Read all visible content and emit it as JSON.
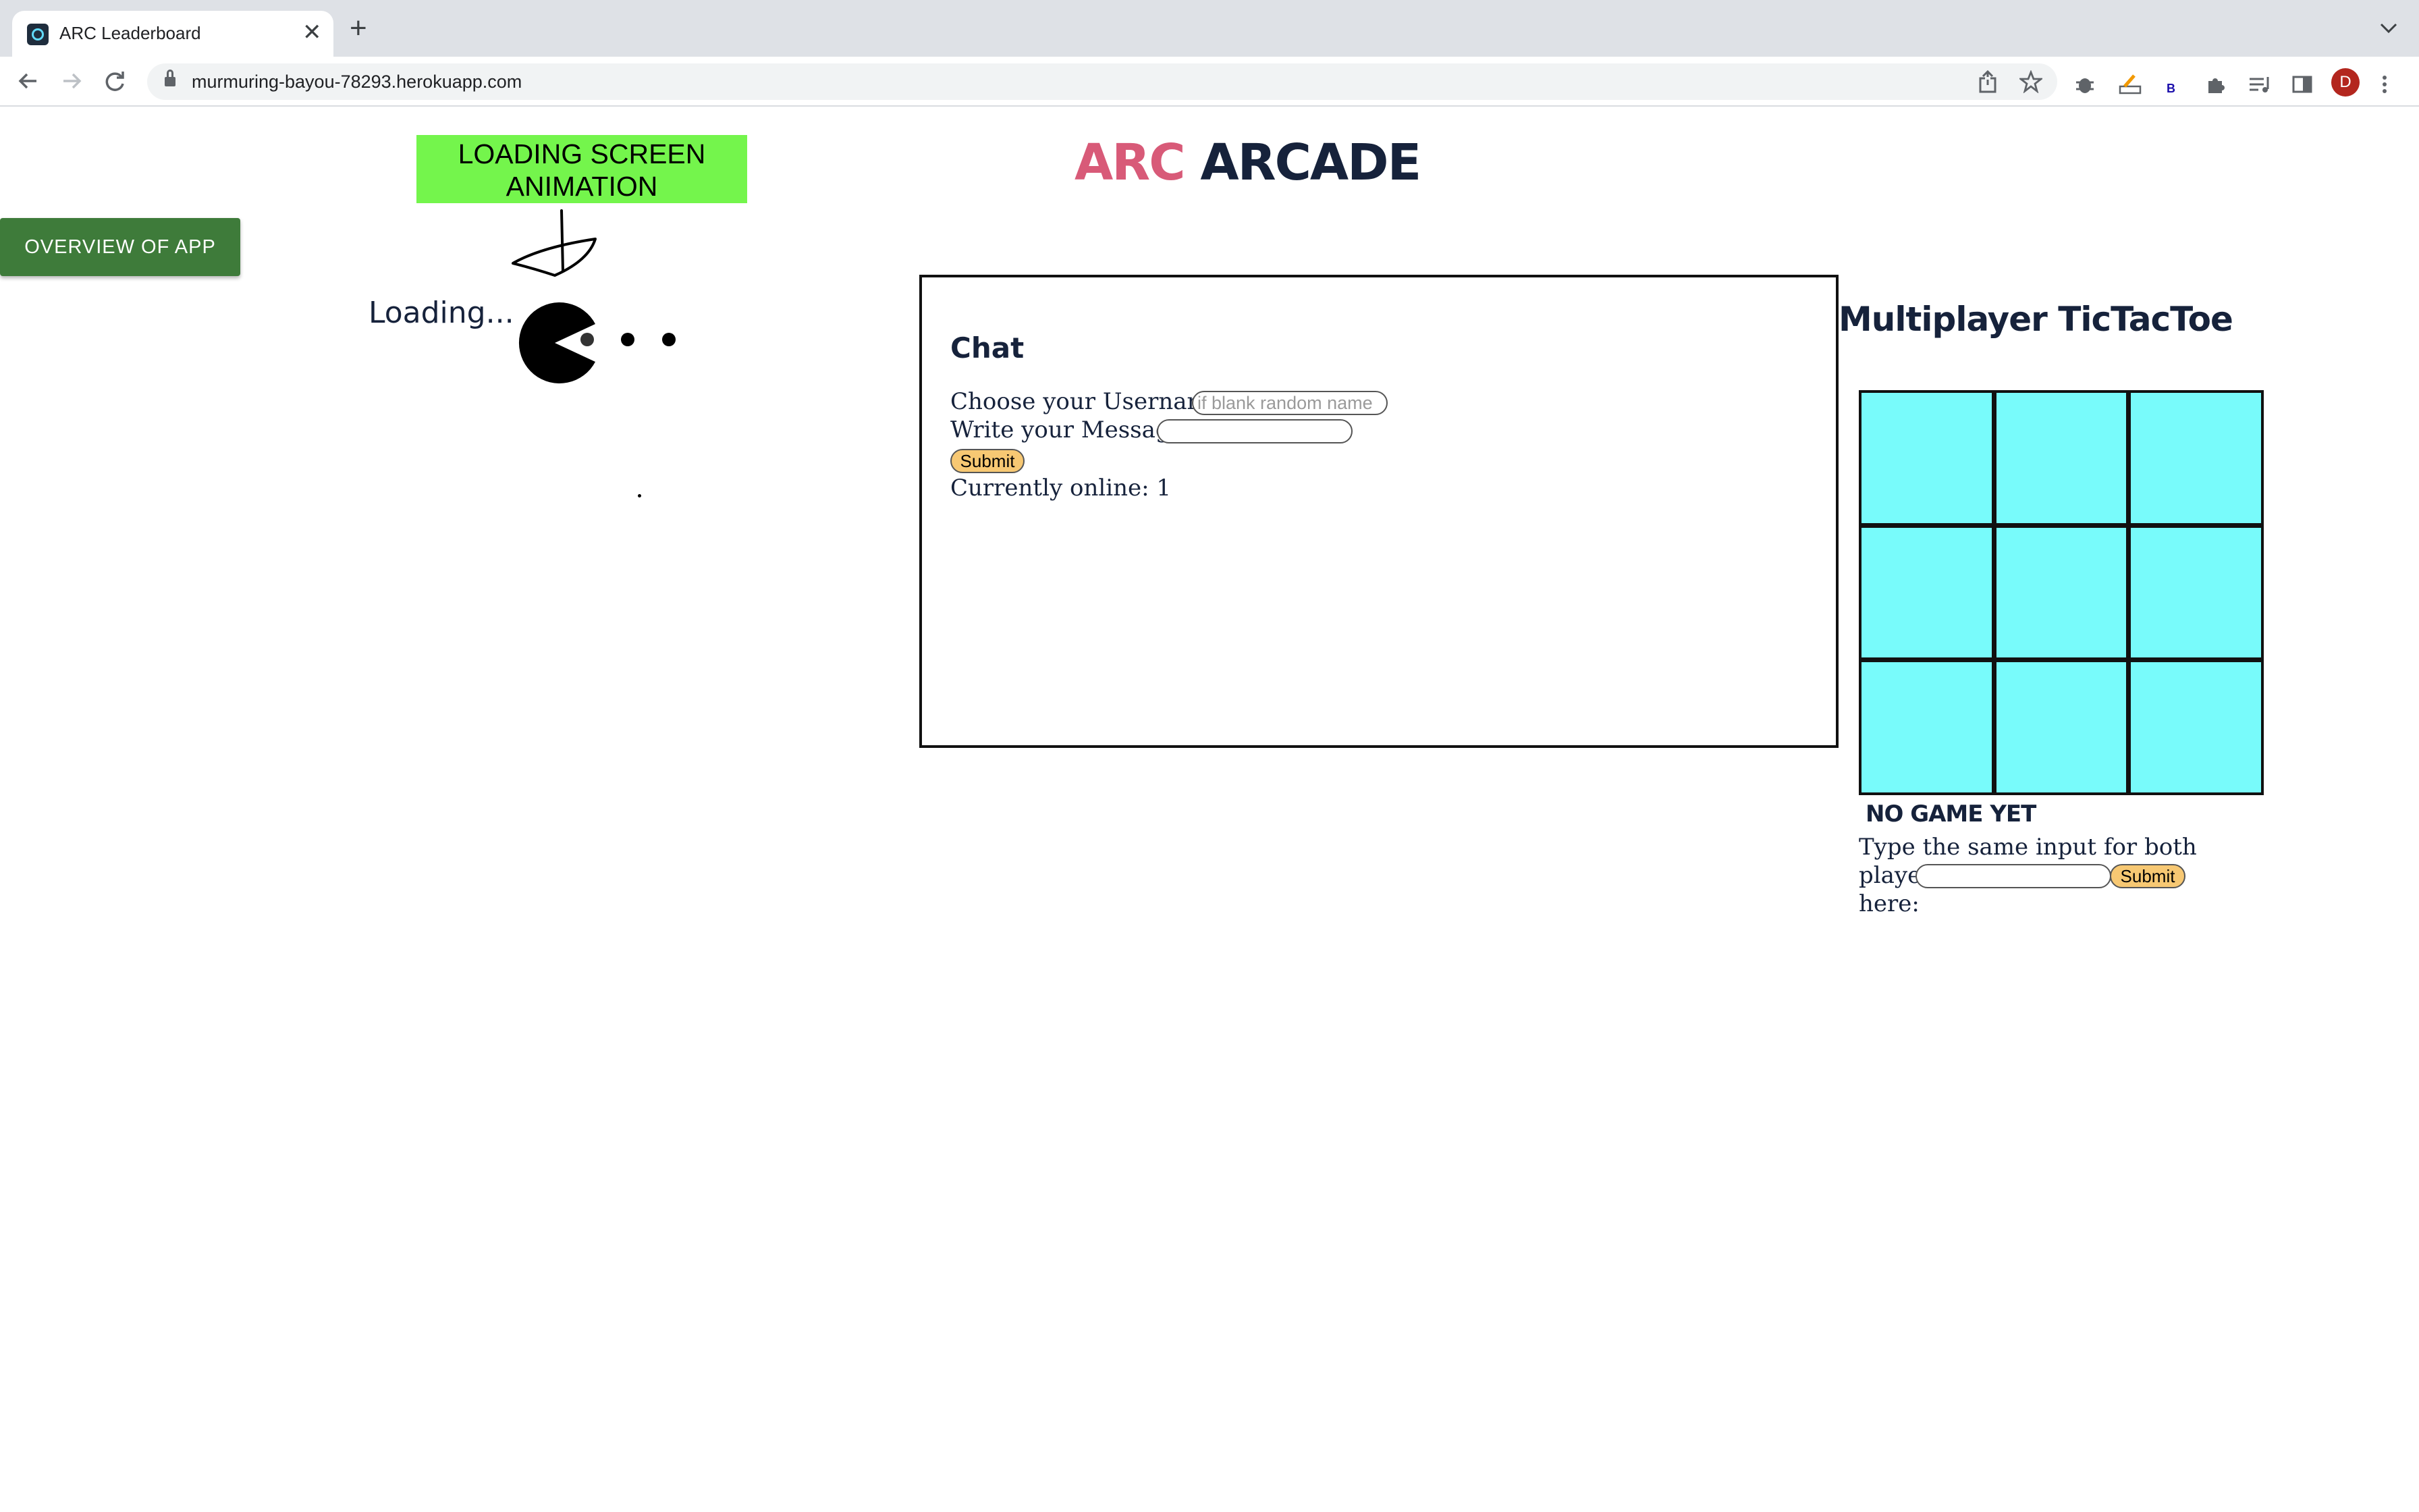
{
  "browser": {
    "tab_title": "ARC Leaderboard",
    "tab_close": "✕",
    "new_tab": "+",
    "url": "murmuring-bayou-78293.herokuapp.com",
    "avatar_initial": "D",
    "extension_b_label": "B"
  },
  "page": {
    "overview_button": "OVERVIEW OF APP",
    "loading_banner_line1": "LOADING SCREEN",
    "loading_banner_line2": "ANIMATION",
    "loading_text": "Loading...",
    "title_part1": "ARC",
    "title_part2": "ARCADE",
    "colors": {
      "overview_button": "#3e7b3a",
      "banner": "#74f54c",
      "title_accent": "#d85a78",
      "title_dark": "#16223b",
      "board_cell": "#78fbfb",
      "submit": "#f7c873"
    }
  },
  "chat": {
    "heading": "Chat",
    "username_label": "Choose your Username!",
    "username_placeholder": "if blank random name",
    "message_label": "Write your Message!",
    "message_value": "",
    "submit_label": "Submit",
    "online_text": "Currently online: 1"
  },
  "tictactoe": {
    "title": "Multiplayer TicTacToe",
    "cells": [
      "",
      "",
      "",
      "",
      "",
      "",
      "",
      "",
      ""
    ],
    "status": "NO GAME YET",
    "prompt_line1": "Type the same input for both players",
    "prompt_line2": "here:",
    "input_value": "",
    "submit_label": "Submit"
  }
}
